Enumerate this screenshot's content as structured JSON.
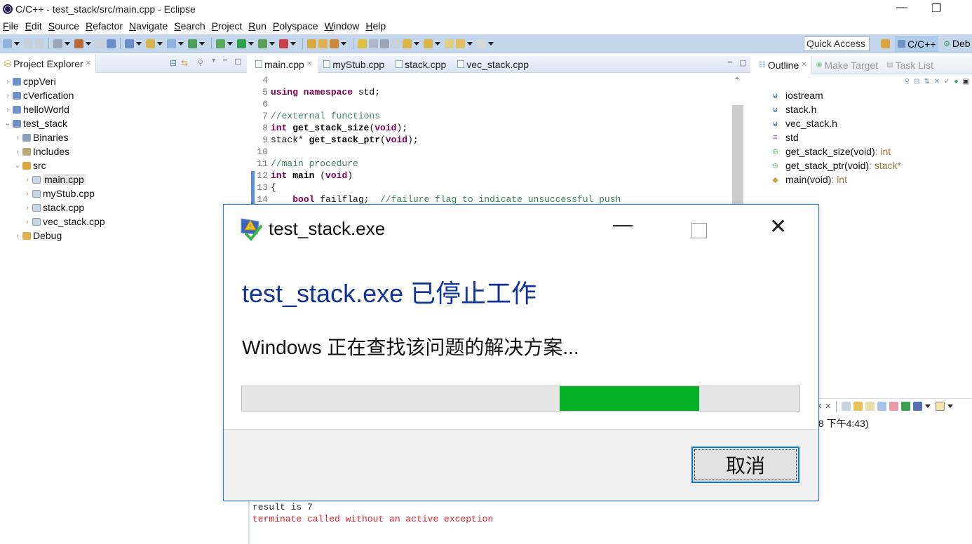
{
  "window": {
    "title": "C/C++ - test_stack/src/main.cpp - Eclipse",
    "controls": {
      "minimize": "—",
      "maximize": "❐",
      "close": "✕"
    }
  },
  "menu": [
    "File",
    "Edit",
    "Source",
    "Refactor",
    "Navigate",
    "Search",
    "Project",
    "Run",
    "Polyspace",
    "Window",
    "Help"
  ],
  "toolbar": {
    "quick_access": "Quick Access",
    "perspectives": [
      {
        "label": "C/C++",
        "active": true
      },
      {
        "label": "Deb",
        "active": false
      }
    ]
  },
  "project_explorer": {
    "title": "Project Explorer",
    "items": [
      {
        "label": "cppVeri",
        "twisty": "›",
        "icon": "project-icon",
        "level": 0
      },
      {
        "label": "cVerfication",
        "twisty": "›",
        "icon": "project-icon",
        "level": 0
      },
      {
        "label": "helloWorld",
        "twisty": "›",
        "icon": "project-icon",
        "level": 0
      },
      {
        "label": "test_stack",
        "twisty": "⌄",
        "icon": "project-icon",
        "level": 0
      },
      {
        "label": "Binaries",
        "twisty": "›",
        "icon": "binaries-icon",
        "level": 1
      },
      {
        "label": "Includes",
        "twisty": "›",
        "icon": "includes-icon",
        "level": 1
      },
      {
        "label": "src",
        "twisty": "⌄",
        "icon": "source-folder-icon",
        "level": 1
      },
      {
        "label": "main.cpp",
        "twisty": "›",
        "icon": "cpp-file-icon",
        "level": 2,
        "selected": true
      },
      {
        "label": "myStub.cpp",
        "twisty": "›",
        "icon": "cpp-file-icon",
        "level": 2
      },
      {
        "label": "stack.cpp",
        "twisty": "›",
        "icon": "cpp-file-icon",
        "level": 2
      },
      {
        "label": "vec_stack.cpp",
        "twisty": "›",
        "icon": "cpp-file-icon",
        "level": 2
      },
      {
        "label": "Debug",
        "twisty": "›",
        "icon": "folder-icon",
        "level": 1
      }
    ]
  },
  "editor": {
    "tabs": [
      {
        "label": "main.cpp",
        "active": true
      },
      {
        "label": "myStub.cpp",
        "active": false
      },
      {
        "label": "stack.cpp",
        "active": false
      },
      {
        "label": "vec_stack.cpp",
        "active": false
      }
    ],
    "lines": [
      {
        "n": "4",
        "tokens": []
      },
      {
        "n": "5",
        "tokens": [
          [
            "kw",
            "using namespace"
          ],
          [
            "",
            " std;"
          ]
        ]
      },
      {
        "n": "6",
        "tokens": []
      },
      {
        "n": "7",
        "tokens": [
          [
            "cm",
            "//external functions"
          ]
        ]
      },
      {
        "n": "8",
        "tokens": [
          [
            "kw",
            "int"
          ],
          [
            "",
            " "
          ],
          [
            "fn",
            "get_stack_size"
          ],
          [
            "",
            "("
          ],
          [
            "kw",
            "void"
          ],
          [
            "",
            ");"
          ]
        ]
      },
      {
        "n": "9",
        "tokens": [
          [
            "",
            "stack* "
          ],
          [
            "fn",
            "get_stack_ptr"
          ],
          [
            "",
            "("
          ],
          [
            "kw",
            "void"
          ],
          [
            "",
            ");"
          ]
        ]
      },
      {
        "n": "10",
        "tokens": []
      },
      {
        "n": "11",
        "tokens": [
          [
            "cm",
            "//main procedure"
          ]
        ]
      },
      {
        "n": "12",
        "tokens": [
          [
            "kw",
            "int"
          ],
          [
            "",
            " "
          ],
          [
            "fn",
            "main"
          ],
          [
            "",
            " ("
          ],
          [
            "kw",
            "void"
          ],
          [
            "",
            ")"
          ]
        ]
      },
      {
        "n": "13",
        "tokens": [
          [
            "",
            "{"
          ]
        ]
      },
      {
        "n": "14",
        "tokens": [
          [
            "",
            "    "
          ],
          [
            "kw",
            "bool"
          ],
          [
            "",
            " failflag;  "
          ],
          [
            "cm",
            "//failure flag to indicate unsuccessful push"
          ]
        ]
      }
    ]
  },
  "outline": {
    "tabs": [
      "Outline",
      "Make Target",
      "Task List"
    ],
    "items": [
      {
        "label": "iostream",
        "type": "",
        "icon": "include-icon"
      },
      {
        "label": "stack.h",
        "type": "",
        "icon": "include-icon"
      },
      {
        "label": "vec_stack.h",
        "type": "",
        "icon": "include-icon"
      },
      {
        "label": "std",
        "type": "",
        "icon": "namespace-icon"
      },
      {
        "label": "get_stack_size(void)",
        "type": " : int",
        "icon": "function-decl-icon"
      },
      {
        "label": "get_stack_ptr(void)",
        "type": " : stack*",
        "icon": "function-decl-icon"
      },
      {
        "label": "main(void)",
        "type": " : int",
        "icon": "function-icon"
      }
    ]
  },
  "console": {
    "header_fragment": "/8 下午4:43)",
    "lines": [
      {
        "text": "result is 7",
        "color": "#333333"
      },
      {
        "text": "terminate called without an active exception",
        "color": "#e8202a"
      }
    ]
  },
  "dialog": {
    "title": "test_stack.exe",
    "heading": "test_stack.exe 已停止工作",
    "message": "Windows 正在查找该问题的解决方案...",
    "progress": {
      "state": "indeterminate",
      "fill_start": 0.57,
      "fill_end": 0.82,
      "color": "#06b025"
    },
    "cancel_label": "取消",
    "heading_color": "#0f3396"
  }
}
